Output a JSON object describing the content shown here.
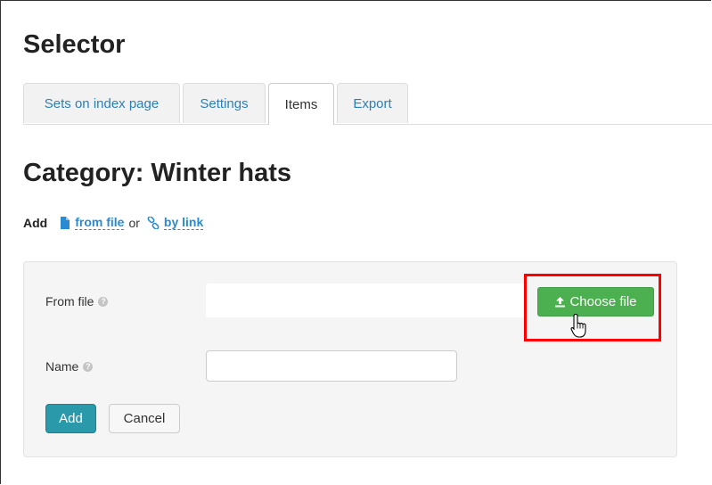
{
  "page": {
    "title": "Selector"
  },
  "tabs": [
    {
      "label": "Sets on index page",
      "active": false
    },
    {
      "label": "Settings",
      "active": false
    },
    {
      "label": "Items",
      "active": true
    },
    {
      "label": "Export",
      "active": false
    }
  ],
  "category": {
    "title": "Category: Winter hats"
  },
  "add_line": {
    "label": "Add",
    "from_file": "from file",
    "or": "or",
    "by_link": "by link",
    "icons": [
      "file-icon",
      "link-icon"
    ]
  },
  "form": {
    "from_file_label": "From file",
    "choose_file_label": "Choose file",
    "name_label": "Name",
    "name_value": "",
    "help_glyph": "?",
    "add_label": "Add",
    "cancel_label": "Cancel"
  },
  "colors": {
    "accent_link": "#2a8bd3",
    "choose_button": "#4caf50",
    "add_button": "#2a9aab",
    "highlight": "#ff0000"
  }
}
